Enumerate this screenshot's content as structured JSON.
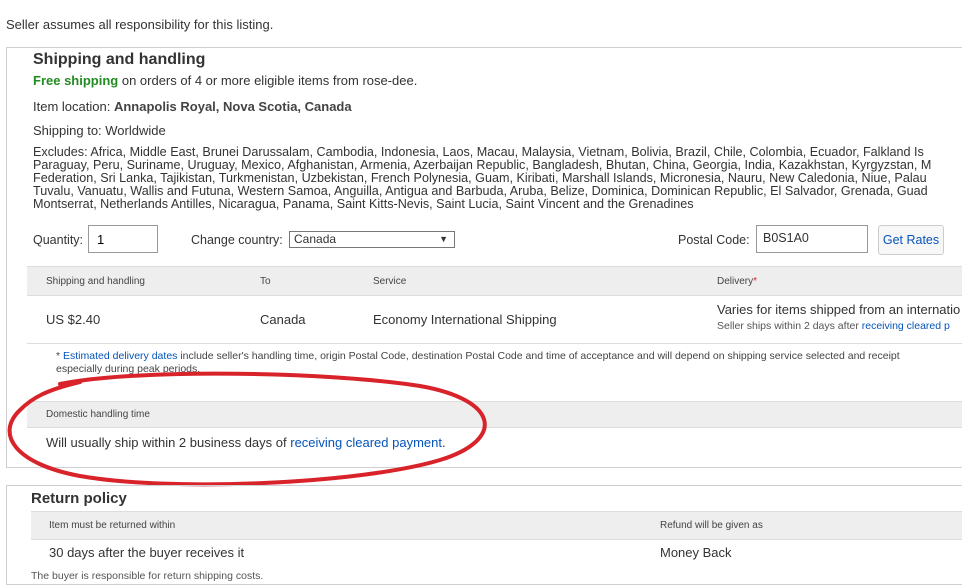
{
  "notice": "Seller assumes all responsibility for this listing.",
  "shipping": {
    "title": "Shipping and handling",
    "free_label": "Free shipping",
    "free_rest": " on orders of 4 or more eligible items from rose-dee.",
    "location_label": "Item location: ",
    "location_value": "Annapolis Royal, Nova Scotia, Canada",
    "ships_to": "Shipping to: Worldwide",
    "excludes_lines": [
      "Excludes: Africa, Middle East, Brunei Darussalam, Cambodia, Indonesia, Laos, Macau, Malaysia, Vietnam, Bolivia, Brazil, Chile, Colombia, Ecuador, Falkland Is",
      "Paraguay, Peru, Suriname, Uruguay, Mexico, Afghanistan, Armenia, Azerbaijan Republic, Bangladesh, Bhutan, China, Georgia, India, Kazakhstan, Kyrgyzstan, M",
      "Federation, Sri Lanka, Tajikistan, Turkmenistan, Uzbekistan, French Polynesia, Guam, Kiribati, Marshall Islands, Micronesia, Nauru, New Caledonia, Niue, Palau",
      "Tuvalu, Vanuatu, Wallis and Futuna, Western Samoa, Anguilla, Antigua and Barbuda, Aruba, Belize, Dominica, Dominican Republic, El Salvador, Grenada, Guad",
      "Montserrat, Netherlands Antilles, Nicaragua, Panama, Saint Kitts-Nevis, Saint Lucia, Saint Vincent and the Grenadines"
    ],
    "quantity_label": "Quantity:",
    "quantity_value": "1",
    "country_label": "Change country:",
    "country_value": "Canada",
    "postal_label": "Postal Code:",
    "postal_value": "B0S1A0",
    "get_rates": "Get Rates",
    "columns": {
      "shipping": "Shipping and handling",
      "to": "To",
      "service": "Service",
      "delivery": "Delivery",
      "delivery_star": "*"
    },
    "row": {
      "cost": "US $2.40",
      "to": "Canada",
      "service": "Economy International Shipping",
      "delivery": "Varies for items shipped from an internatio",
      "delivery_sub": "Seller ships within 2 days after ",
      "delivery_sub_link": "receiving cleared p"
    },
    "note_star": "* ",
    "note_link": "Estimated delivery dates",
    "note_rest": " include seller's handling time, origin Postal Code, destination Postal Code and time of acceptance and will depend on shipping service selected and receipt",
    "note_line2": "especially during peak periods.",
    "handling_header": "Domestic handling time",
    "handling_text": "Will usually ship within 2 business days of ",
    "handling_link": "receiving cleared payment",
    "handling_end": "."
  },
  "returns": {
    "title": "Return policy",
    "col_within": "Item must be returned within",
    "col_refund": "Refund will be given as",
    "within_value": "30 days after the buyer receives it",
    "refund_value": "Money Back",
    "note": "The buyer is responsible for return shipping costs."
  },
  "colors": {
    "link": "#0654ba",
    "free_shipping": "#228b22",
    "annotation_oval": "#d8232a"
  }
}
